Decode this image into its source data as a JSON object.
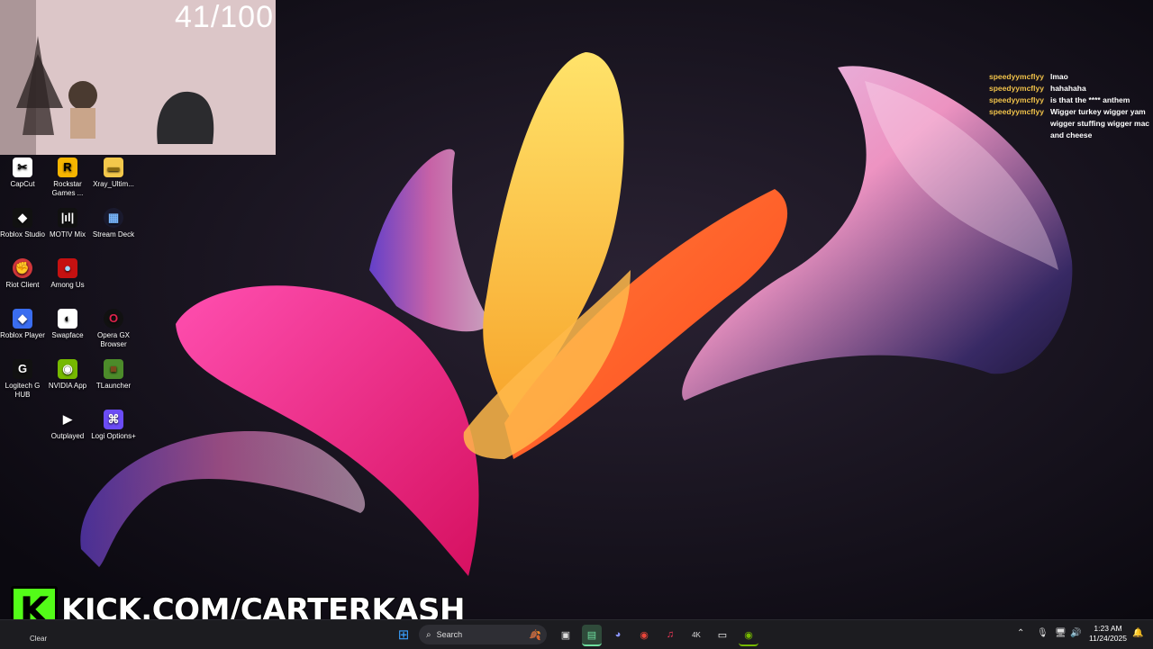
{
  "webcam": {
    "counter": "41/100"
  },
  "desktop_icons": [
    {
      "label": "CapCut",
      "icon": "capcut-icon"
    },
    {
      "label": "Rockstar Games ...",
      "icon": "rockstar-icon"
    },
    {
      "label": "Xray_Ultim...",
      "icon": "folder-icon"
    },
    {
      "label": "Roblox Studio",
      "icon": "roblox-studio-icon"
    },
    {
      "label": "MOTIV Mix",
      "icon": "motiv-mix-icon"
    },
    {
      "label": "Stream Deck",
      "icon": "stream-deck-icon"
    },
    {
      "label": "Riot Client",
      "icon": "riot-client-icon"
    },
    {
      "label": "Among Us",
      "icon": "among-us-icon"
    },
    {
      "label": "Roblox Player",
      "icon": "roblox-player-icon"
    },
    {
      "label": "Swapface",
      "icon": "swapface-icon"
    },
    {
      "label": "Opera GX Browser",
      "icon": "opera-gx-icon"
    },
    {
      "label": "Logitech G HUB",
      "icon": "logitech-ghub-icon"
    },
    {
      "label": "NVIDIA App",
      "icon": "nvidia-icon"
    },
    {
      "label": "TLauncher",
      "icon": "tlauncher-icon"
    },
    {
      "label": "Outplayed",
      "icon": "outplayed-icon"
    },
    {
      "label": "Logi Options+",
      "icon": "logi-options-icon"
    }
  ],
  "chat": [
    {
      "user": "speedyymcflyy",
      "msg": "lmao"
    },
    {
      "user": "speedyymcflyy",
      "msg": "hahahaha"
    },
    {
      "user": "speedyymcflyy",
      "msg": "is that the **** anthem"
    },
    {
      "user": "speedyymcflyy",
      "msg": "Wigger turkey wigger yam\nwigger stuffing wigger mac\nand cheese"
    }
  ],
  "banner": {
    "k": "K",
    "url": "KICK.COM/CARTERKASH"
  },
  "taskbar": {
    "search_label": "Search",
    "clear_label": "Clear",
    "time": "1:23 AM",
    "date": "11/24/2025",
    "apps": [
      "start-icon",
      "task-view-icon",
      "terminal-icon",
      "discord-icon",
      "chrome-icon",
      "music-icon",
      "4k-app-icon",
      "pc-app-icon",
      "nvidia-icon"
    ]
  },
  "colors": {
    "kick_green": "#53fc18",
    "chat_user": "#f0c24a",
    "taskbar": "#1c1c20"
  }
}
